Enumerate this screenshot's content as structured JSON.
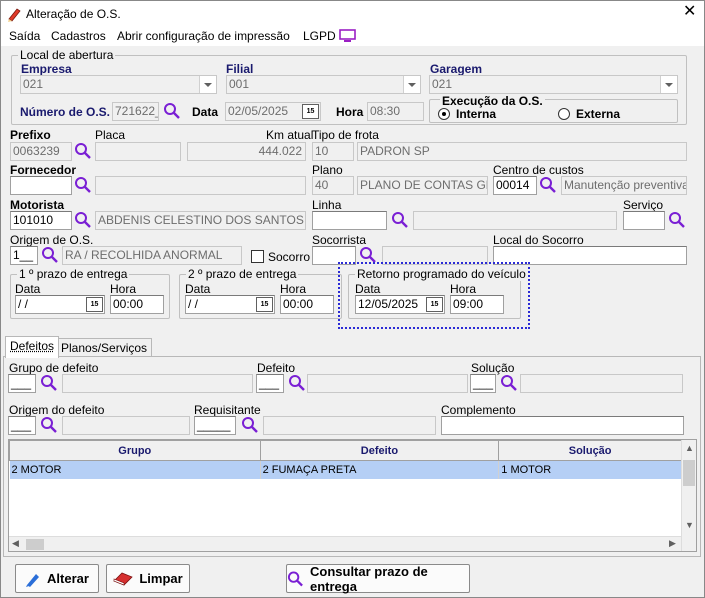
{
  "window": {
    "title": "Alteração de O.S.",
    "close_glyph": "✕"
  },
  "menu": {
    "items": [
      "Saída",
      "Cadastros",
      "Abrir configuração de impressão",
      "LGPD"
    ]
  },
  "local_abertura": {
    "caption": "Local de abertura",
    "empresa_label": "Empresa",
    "empresa_value": "021",
    "filial_label": "Filial",
    "filial_value": "001",
    "garagem_label": "Garagem",
    "garagem_value": "021",
    "numero_os_label": "Número de O.S.",
    "numero_os_value": "721622_",
    "data_label": "Data",
    "data_value": "02/05/2025",
    "hora_label": "Hora",
    "hora_value": "08:30",
    "execucao_caption": "Execução da O.S.",
    "interna_label": "Interna",
    "externa_label": "Externa"
  },
  "veiculo": {
    "prefixo_label": "Prefixo",
    "prefixo_value": "0063239",
    "placa_label": "Placa",
    "placa_value": "",
    "km_label": "Km atual",
    "km_value": "444.022",
    "tipo_frota_label": "Tipo de frota",
    "tipo_frota_code": "10",
    "tipo_frota_value": "PADRON SP"
  },
  "fornecedor": {
    "label": "Fornecedor",
    "value": "",
    "desc": "",
    "plano_label": "Plano",
    "plano_code": "40",
    "plano_value": "PLANO DE CONTAS GER",
    "centro_label": "Centro de custos",
    "centro_code": "00014",
    "centro_value": "Manutenção preventiva"
  },
  "motorista": {
    "label": "Motorista",
    "value": "101010",
    "name": "ABDENIS CELESTINO DOS SANTOS",
    "linha_label": "Linha",
    "linha_value": "",
    "linha_desc": "",
    "servico_label": "Serviço",
    "servico_value": ""
  },
  "origem": {
    "label": "Origem de O.S.",
    "code": "1__",
    "desc": "RA / RECOLHIDA ANORMAL",
    "socorro_label": "Socorro",
    "socorrista_label": "Socorrista",
    "socorrista_value": "",
    "local_label": "Local do Socorro",
    "local_value": ""
  },
  "prazo1": {
    "caption": "1 º prazo de entrega",
    "data_label": "Data",
    "data_value": " / /",
    "hora_label": "Hora",
    "hora_value": "00:00"
  },
  "prazo2": {
    "caption": "2 º prazo de entrega",
    "data_label": "Data",
    "data_value": " / /",
    "hora_label": "Hora",
    "hora_value": "00:00"
  },
  "retorno": {
    "caption": "Retorno programado do veículo",
    "data_label": "Data",
    "data_value": "12/05/2025",
    "hora_label": "Hora",
    "hora_value": "09:00"
  },
  "tabs": {
    "defeitos": "Defeitos",
    "planos": "Planos/Serviços"
  },
  "defeitos": {
    "grupo_label": "Grupo de defeito",
    "grupo_value": "___",
    "defeito_label": "Defeito",
    "defeito_value": "___",
    "solucao_label": "Solução",
    "solucao_value": "___",
    "origem_label": "Origem do defeito",
    "origem_value": "___",
    "requisitante_label": "Requisitante",
    "requisitante_value": "_____",
    "complemento_label": "Complemento",
    "complemento_value": ""
  },
  "grid": {
    "headers": [
      "Grupo",
      "Defeito",
      "Solução"
    ],
    "rows": [
      [
        "2 MOTOR",
        "2 FUMAÇA PRETA",
        "1 MOTOR"
      ]
    ]
  },
  "buttons": {
    "alterar": "Alterar",
    "limpar": "Limpar",
    "consultar": "Consultar prazo de entrega"
  },
  "colors": {
    "accent": "#3b30c4",
    "focus_border": "#2b2bd6",
    "selection": "#b5cff5",
    "label_navy": "#1a1a6e"
  }
}
